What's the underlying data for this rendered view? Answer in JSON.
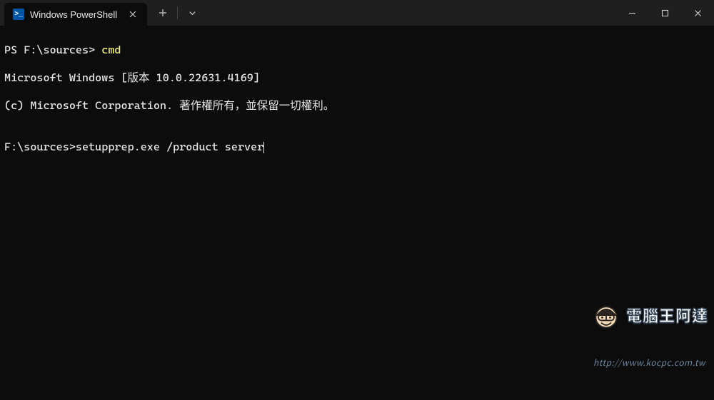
{
  "titlebar": {
    "tab_title": "Windows PowerShell",
    "new_tab_label": "+",
    "dropdown_label": "⌄"
  },
  "terminal": {
    "line1_prompt": "PS F:\\sources> ",
    "line1_cmd": "cmd",
    "line2": "Microsoft Windows [版本 10.0.22631.4169]",
    "line3": "(c) Microsoft Corporation. 著作權所有，並保留一切權利。",
    "blank": "",
    "line4_prompt": "F:\\sources>",
    "line4_input": "setupprep.exe /product server"
  },
  "watermark": {
    "brand": "電腦王阿達",
    "url": "http://www.kocpc.com.tw"
  }
}
